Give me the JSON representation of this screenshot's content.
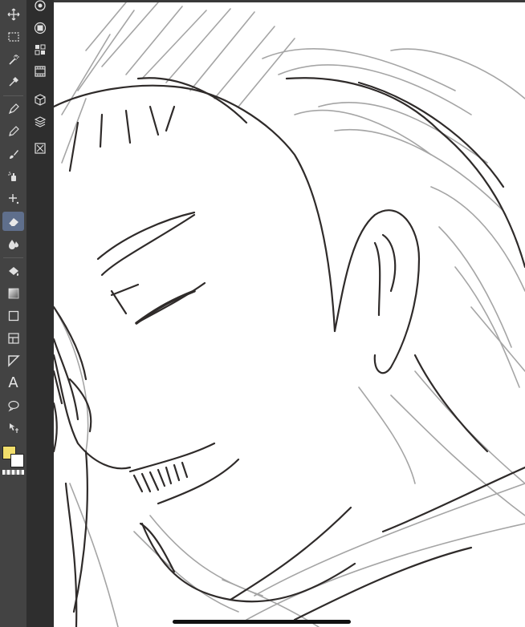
{
  "app": {
    "name": ""
  },
  "colors": {
    "toolbar_bg": "#434343",
    "palette_bg": "#2e2e2e",
    "active_tool_bg": "#5f6f8c",
    "main_color": "#f1de6b",
    "sub_color": "#ffffff",
    "canvas_bg": "#ffffff",
    "sketch_dark": "#2f2b2a",
    "sketch_light": "#9c9c9c"
  },
  "toolbar": {
    "active_tool": "eraser",
    "tools": [
      {
        "name": "move-icon"
      },
      {
        "name": "selection-rect-icon"
      },
      {
        "name": "magic-wand-icon"
      },
      {
        "name": "eyedropper-icon"
      },
      {
        "name": "pen-icon"
      },
      {
        "name": "pencil-icon"
      },
      {
        "name": "brush-icon"
      },
      {
        "name": "airbrush-icon"
      },
      {
        "name": "decoration-icon"
      },
      {
        "name": "eraser-icon"
      },
      {
        "name": "blend-icon"
      },
      {
        "name": "fill-icon"
      },
      {
        "name": "gradient-icon"
      },
      {
        "name": "figure-icon"
      },
      {
        "name": "frame-border-icon"
      },
      {
        "name": "ruler-icon"
      },
      {
        "name": "text-icon"
      },
      {
        "name": "balloon-icon"
      },
      {
        "name": "operation-icon"
      }
    ],
    "text_tool_glyph": "A"
  },
  "palette_bar": {
    "items": [
      {
        "name": "color-wheel-icon"
      },
      {
        "name": "layer-property-icon"
      },
      {
        "name": "material-icon"
      },
      {
        "name": "timeline-icon"
      },
      {
        "name": "3d-object-icon"
      },
      {
        "name": "layers-icon"
      },
      {
        "name": "navigator-icon"
      }
    ]
  }
}
